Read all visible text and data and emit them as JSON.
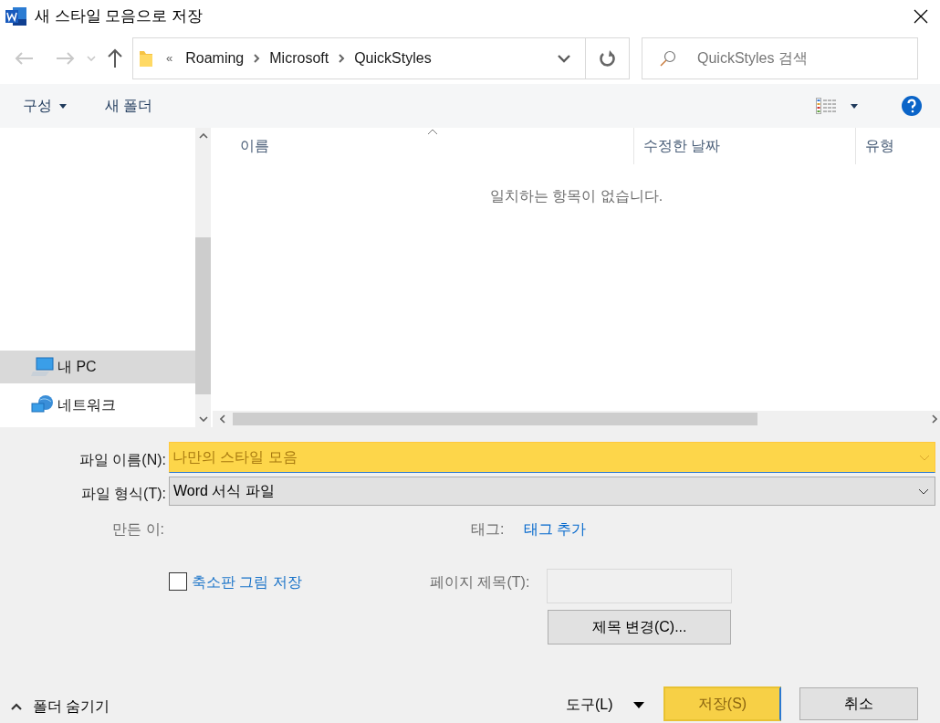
{
  "window": {
    "title": "새 스타일 모음으로 저장"
  },
  "nav": {
    "breadcrumb_overflow": "«",
    "path": [
      "Roaming",
      "Microsoft",
      "QuickStyles"
    ],
    "search": {
      "placeholder": "QuickStyles 검색"
    }
  },
  "toolbar": {
    "organize": "구성",
    "new_folder": "새 폴더"
  },
  "sidebar": {
    "items": [
      {
        "label": "내 PC",
        "kind": "pc",
        "selected": true
      },
      {
        "label": "네트워크",
        "kind": "network",
        "selected": false
      }
    ]
  },
  "file_list": {
    "columns": [
      {
        "label": "이름",
        "sorted": true
      },
      {
        "label": "수정한 날짜",
        "sorted": false
      },
      {
        "label": "유형",
        "sorted": false
      }
    ],
    "empty_message": "일치하는 항목이 없습니다."
  },
  "form": {
    "file_name": {
      "label": "파일 이름(N):",
      "value": "나만의 스타일 모음"
    },
    "file_type": {
      "label": "파일 형식(T):",
      "value": "Word 서식 파일"
    },
    "author": {
      "label": "만든 이:"
    },
    "tags": {
      "label": "태그:",
      "link": "태그 추가"
    },
    "thumbnail": {
      "label": "축소판 그림 저장",
      "checked": false
    },
    "page_title": {
      "label": "페이지 제목(T):"
    },
    "change_title": "제목 변경(C)..."
  },
  "footer": {
    "hide_folders": "폴더 숨기기",
    "tools": "도구(L)",
    "save": "저장(S)",
    "cancel": "취소"
  }
}
